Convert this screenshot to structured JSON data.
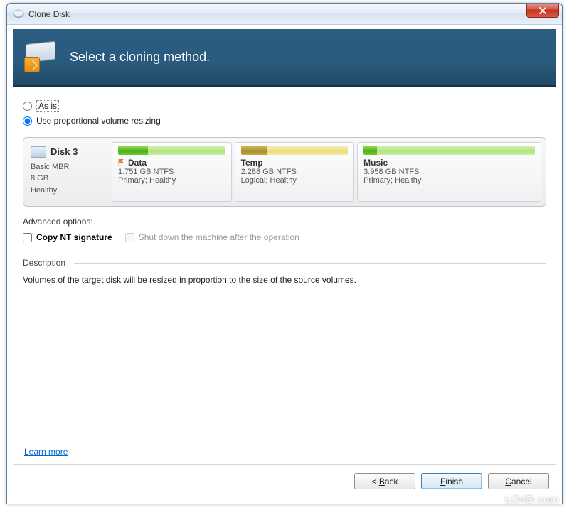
{
  "window": {
    "title": "Clone Disk"
  },
  "banner": {
    "heading": "Select a cloning method."
  },
  "options": {
    "as_is": "As is",
    "proportional": "Use proportional volume resizing",
    "selected": "proportional"
  },
  "disk": {
    "name": "Disk 3",
    "type": "Basic MBR",
    "size": "8 GB",
    "status": "Healthy"
  },
  "volumes": [
    {
      "name": "Data",
      "size": "1.751 GB NTFS",
      "status": "Primary; Healthy",
      "bar_color": "green",
      "bar_track": "green-light",
      "fill_pct": 28,
      "flagged": true
    },
    {
      "name": "Temp",
      "size": "2.288 GB NTFS",
      "status": "Logical; Healthy",
      "bar_color": "olive",
      "bar_track": "yellow",
      "fill_pct": 24,
      "flagged": false
    },
    {
      "name": "Music",
      "size": "3.958 GB NTFS",
      "status": "Primary; Healthy",
      "bar_color": "green",
      "bar_track": "green-light",
      "fill_pct": 8,
      "flagged": false
    }
  ],
  "advanced": {
    "label": "Advanced options:",
    "copy_nt": "Copy NT signature",
    "shutdown": "Shut down the machine after the operation"
  },
  "description": {
    "label": "Description",
    "text": "Volumes of the target disk will be resized in proportion to the size of the source volumes."
  },
  "links": {
    "learn_more": "Learn more"
  },
  "buttons": {
    "back": "Back",
    "finish": "Finish",
    "cancel": "Cancel"
  },
  "watermark": "LO4D.com"
}
